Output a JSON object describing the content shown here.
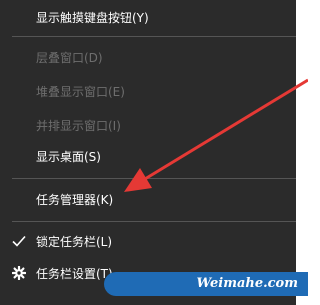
{
  "menu": {
    "items": [
      {
        "label": "显示触摸键盘按钮(Y)",
        "enabled": true
      },
      {
        "label": "层叠窗口(D)",
        "enabled": false
      },
      {
        "label": "堆叠显示窗口(E)",
        "enabled": false
      },
      {
        "label": "并排显示窗口(I)",
        "enabled": false
      },
      {
        "label": "显示桌面(S)",
        "enabled": true
      },
      {
        "label": "任务管理器(K)",
        "enabled": true
      },
      {
        "label": "锁定任务栏(L)",
        "enabled": true,
        "checked": true
      },
      {
        "label": "任务栏设置(T)",
        "enabled": true,
        "icon": "gear-icon"
      }
    ]
  },
  "annotation": {
    "arrow_color": "#e53935"
  },
  "watermark": {
    "text": "Weimahe.com"
  }
}
